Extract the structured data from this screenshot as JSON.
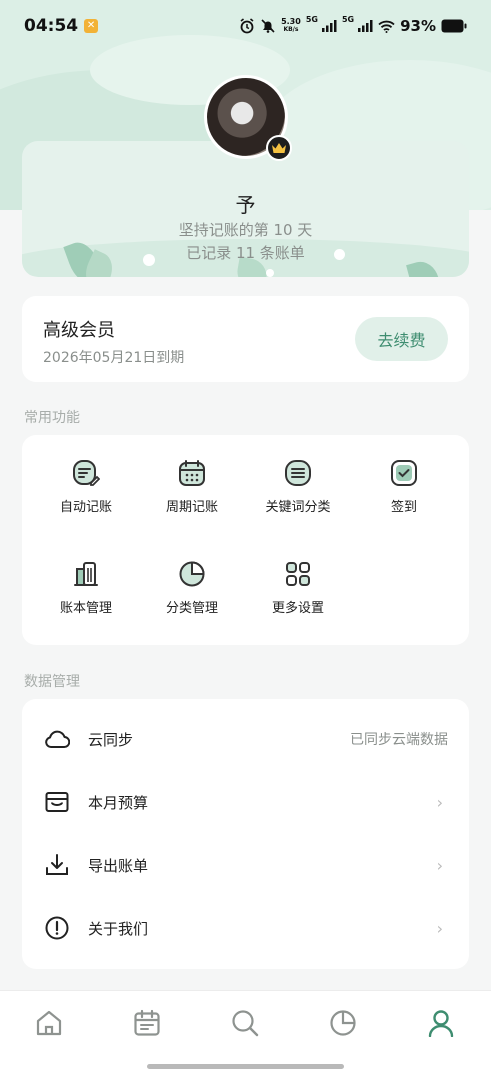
{
  "status_bar": {
    "time": "04:54",
    "net_speed_value": "5.30",
    "net_speed_unit": "KB/s",
    "signal1_label": "5G",
    "signal2_label": "5G",
    "battery_percent": "93%"
  },
  "profile": {
    "username": "予",
    "streak_text": "坚持记账的第 10 天",
    "records_text": "已记录 11 条账单"
  },
  "membership": {
    "title": "高级会员",
    "expiry": "2026年05月21日到期",
    "renew_label": "去续费"
  },
  "functions": {
    "section_title": "常用功能",
    "items": [
      {
        "label": "自动记账",
        "icon": "auto-bookkeeping-icon"
      },
      {
        "label": "周期记账",
        "icon": "calendar-icon"
      },
      {
        "label": "关键词分类",
        "icon": "list-icon"
      },
      {
        "label": "签到",
        "icon": "checkin-icon"
      },
      {
        "label": "账本管理",
        "icon": "ledger-icon"
      },
      {
        "label": "分类管理",
        "icon": "pie-icon"
      },
      {
        "label": "更多设置",
        "icon": "grid-icon"
      }
    ]
  },
  "data_management": {
    "section_title": "数据管理",
    "items": [
      {
        "label": "云同步",
        "value": "已同步云端数据",
        "icon": "cloud-icon"
      },
      {
        "label": "本月预算",
        "value": "",
        "icon": "wallet-icon"
      },
      {
        "label": "导出账单",
        "value": "",
        "icon": "download-icon"
      },
      {
        "label": "关于我们",
        "value": "",
        "icon": "info-icon"
      }
    ]
  },
  "bottom_nav": {
    "active": "profile",
    "items": [
      "home",
      "calendar",
      "search",
      "statistics",
      "profile"
    ]
  },
  "colors": {
    "accent": "#3e8d70",
    "hero_bg": "#dcefe6",
    "page_bg": "#f5f6f6"
  }
}
